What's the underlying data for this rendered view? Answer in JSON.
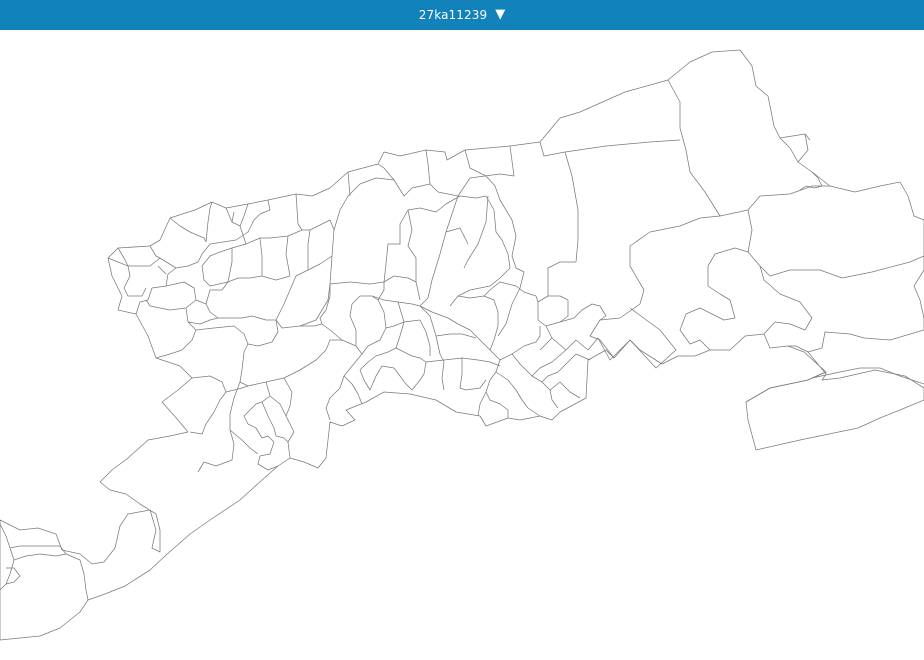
{
  "header": {
    "title": "27ka11239",
    "caret": "▼"
  },
  "colors": {
    "header_bg": "#1183ba",
    "map_stroke": "#7a7a7a",
    "map_fill": "#ffffff"
  },
  "map": {
    "icons": [
      "dropdown-caret-icon"
    ]
  }
}
